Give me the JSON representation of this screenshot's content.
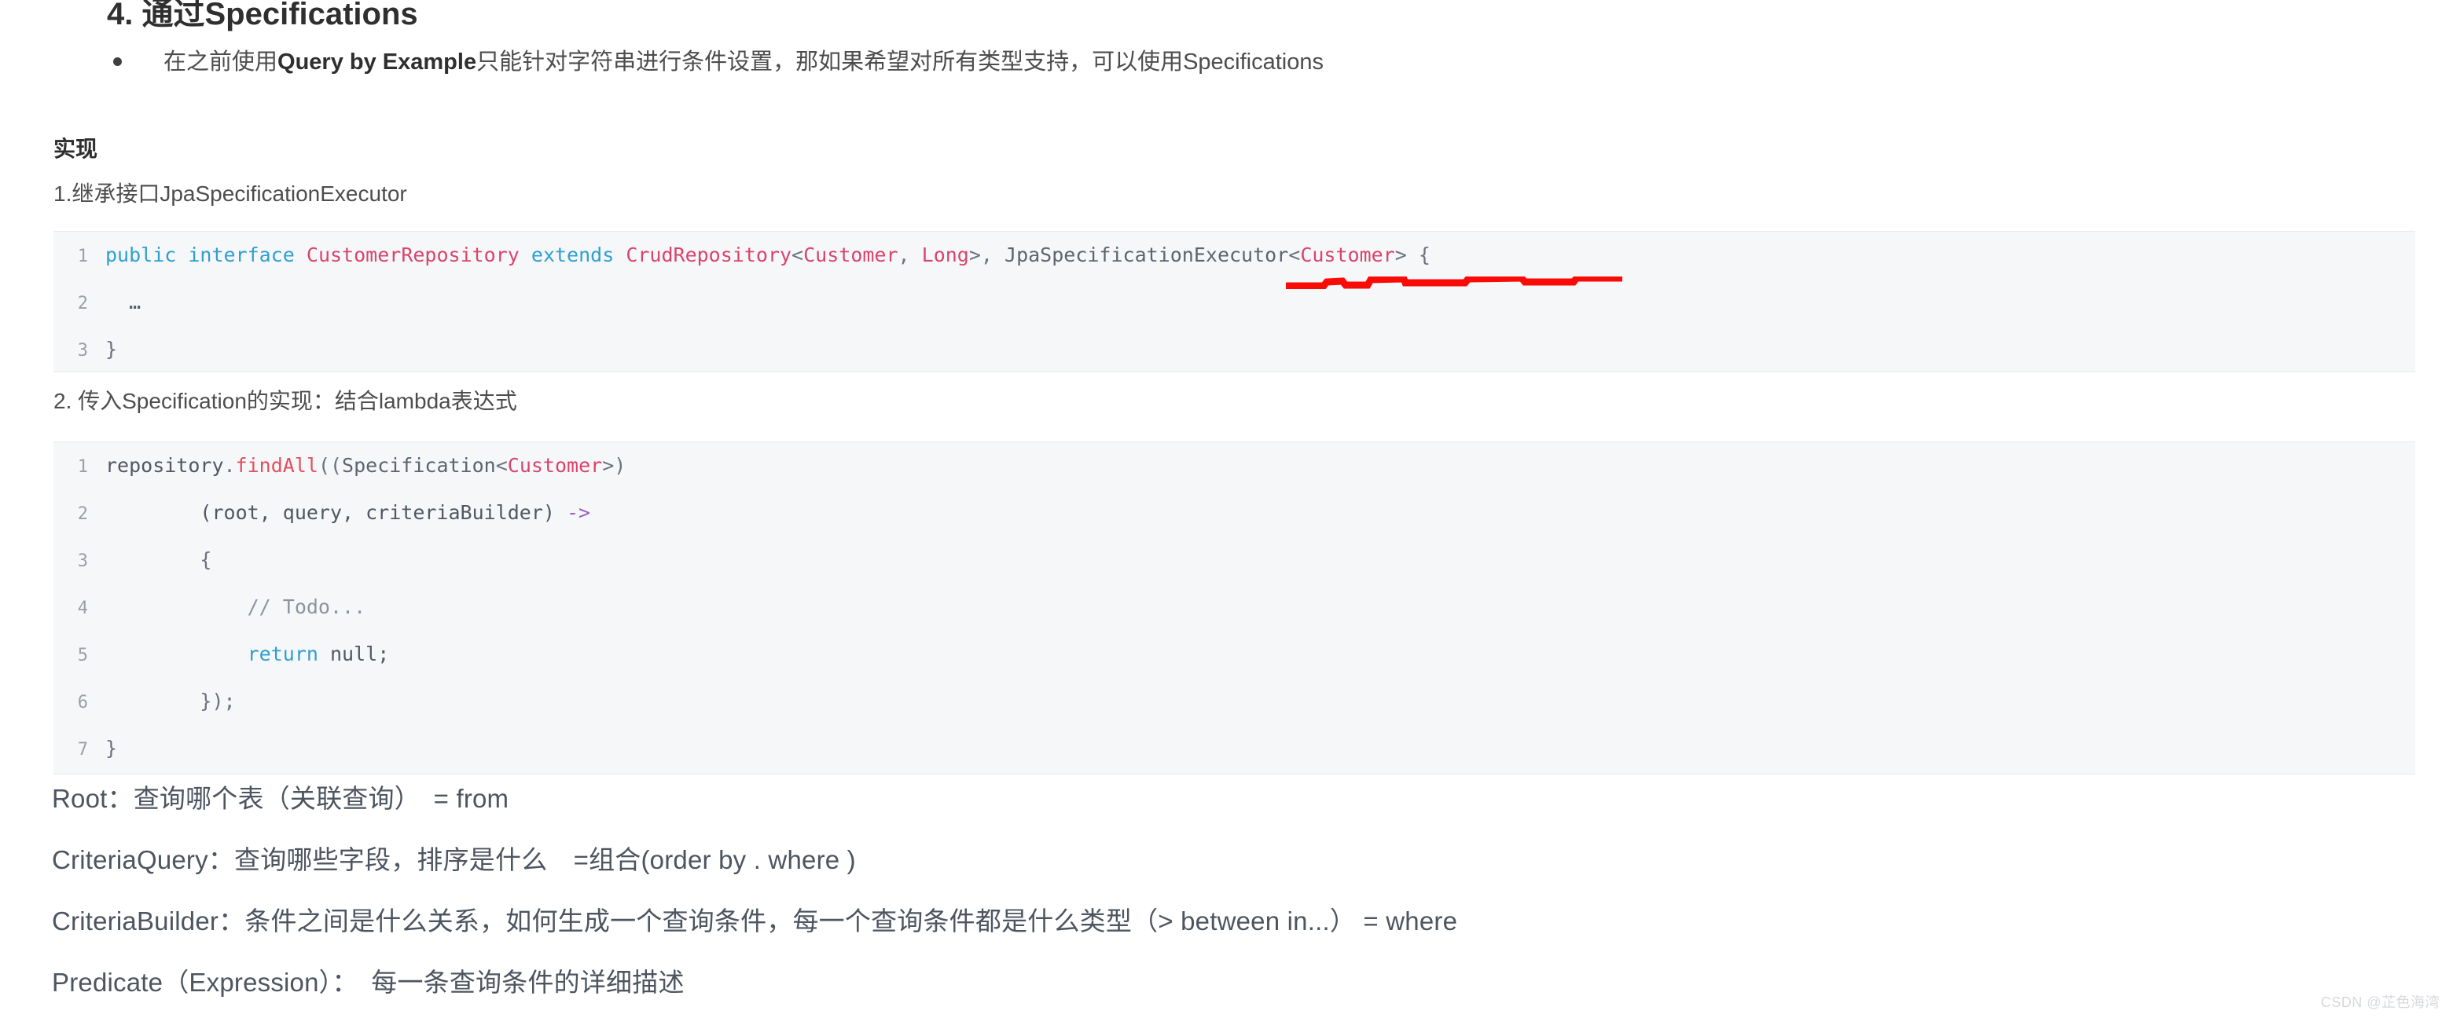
{
  "document": {
    "heading": "4. 通过Specifications",
    "bullets": [
      {
        "prefix": "在之前使用",
        "bold": "Query by Example",
        "suffix": "只能针对字符串进行条件设置，那如果希望对所有类型支持，可以使用Specifications"
      }
    ],
    "sub_heading": "实现",
    "paragraph_1": "1.继承接口JpaSpecificationExecutor",
    "paragraph_2": "2. 传入Specification的实现：结合lambda表达式"
  },
  "code_block_1": {
    "language": "java",
    "lines": [
      {
        "num": "1",
        "tokens": [
          {
            "t": "public",
            "c": "tok-kw"
          },
          {
            "t": " ",
            "c": "tok-plain"
          },
          {
            "t": "interface",
            "c": "tok-kw"
          },
          {
            "t": " ",
            "c": "tok-plain"
          },
          {
            "t": "CustomerRepository",
            "c": "tok-type"
          },
          {
            "t": " ",
            "c": "tok-plain"
          },
          {
            "t": "extends",
            "c": "tok-kw"
          },
          {
            "t": " ",
            "c": "tok-plain"
          },
          {
            "t": "CrudRepository",
            "c": "tok-type"
          },
          {
            "t": "<",
            "c": "tok-punct"
          },
          {
            "t": "Customer",
            "c": "tok-type"
          },
          {
            "t": ", ",
            "c": "tok-punct"
          },
          {
            "t": "Long",
            "c": "tok-type"
          },
          {
            "t": ">, ",
            "c": "tok-punct"
          },
          {
            "t": "JpaSpecificationExecutor",
            "c": "tok-cls"
          },
          {
            "t": "<",
            "c": "tok-punct"
          },
          {
            "t": "Customer",
            "c": "tok-type"
          },
          {
            "t": "> ",
            "c": "tok-punct"
          },
          {
            "t": "{",
            "c": "tok-punct"
          }
        ]
      },
      {
        "num": "2",
        "tokens": [
          {
            "t": "  …",
            "c": "tok-plain"
          }
        ]
      },
      {
        "num": "3",
        "tokens": [
          {
            "t": "}",
            "c": "tok-punct"
          }
        ]
      }
    ]
  },
  "code_block_2": {
    "language": "java",
    "lines": [
      {
        "num": "1",
        "tokens": [
          {
            "t": "repository",
            "c": "tok-plain"
          },
          {
            "t": ".",
            "c": "tok-punct"
          },
          {
            "t": "findAll",
            "c": "tok-fn"
          },
          {
            "t": "((",
            "c": "tok-punct"
          },
          {
            "t": "Specification",
            "c": "tok-cls"
          },
          {
            "t": "<",
            "c": "tok-punct"
          },
          {
            "t": "Customer",
            "c": "tok-type"
          },
          {
            "t": ">)",
            "c": "tok-punct"
          }
        ]
      },
      {
        "num": "2",
        "tokens": [
          {
            "t": "        (root, query, criteriaBuilder) ",
            "c": "tok-plain"
          },
          {
            "t": "->",
            "c": "tok-arrow"
          }
        ]
      },
      {
        "num": "3",
        "tokens": [
          {
            "t": "        {",
            "c": "tok-punct"
          }
        ]
      },
      {
        "num": "4",
        "tokens": [
          {
            "t": "            // Todo...",
            "c": "tok-cmt"
          }
        ]
      },
      {
        "num": "5",
        "tokens": [
          {
            "t": "            ",
            "c": "tok-plain"
          },
          {
            "t": "return",
            "c": "tok-kw"
          },
          {
            "t": " null;",
            "c": "tok-plain"
          }
        ]
      },
      {
        "num": "6",
        "tokens": [
          {
            "t": "        });",
            "c": "tok-punct"
          }
        ]
      },
      {
        "num": "7",
        "tokens": [
          {
            "t": "}",
            "c": "tok-punct"
          }
        ]
      }
    ]
  },
  "annotations": [
    {
      "type": "hand-drawn-underline",
      "color": "#fb0b06",
      "target_text": "JpaSpecificationExecutor"
    }
  ],
  "explanations": [
    "Root：查询哪个表（关联查询）　= from",
    "CriteriaQuery：查询哪些字段，排序是什么　=组合(order by . where )",
    "CriteriaBuilder：条件之间是什么关系，如何生成一个查询条件，每一个查询条件都是什么类型（>  between in...）  = where",
    "Predicate（Expression）：　每一条查询条件的详细描述"
  ],
  "watermark": "CSDN @芷色海湾"
}
